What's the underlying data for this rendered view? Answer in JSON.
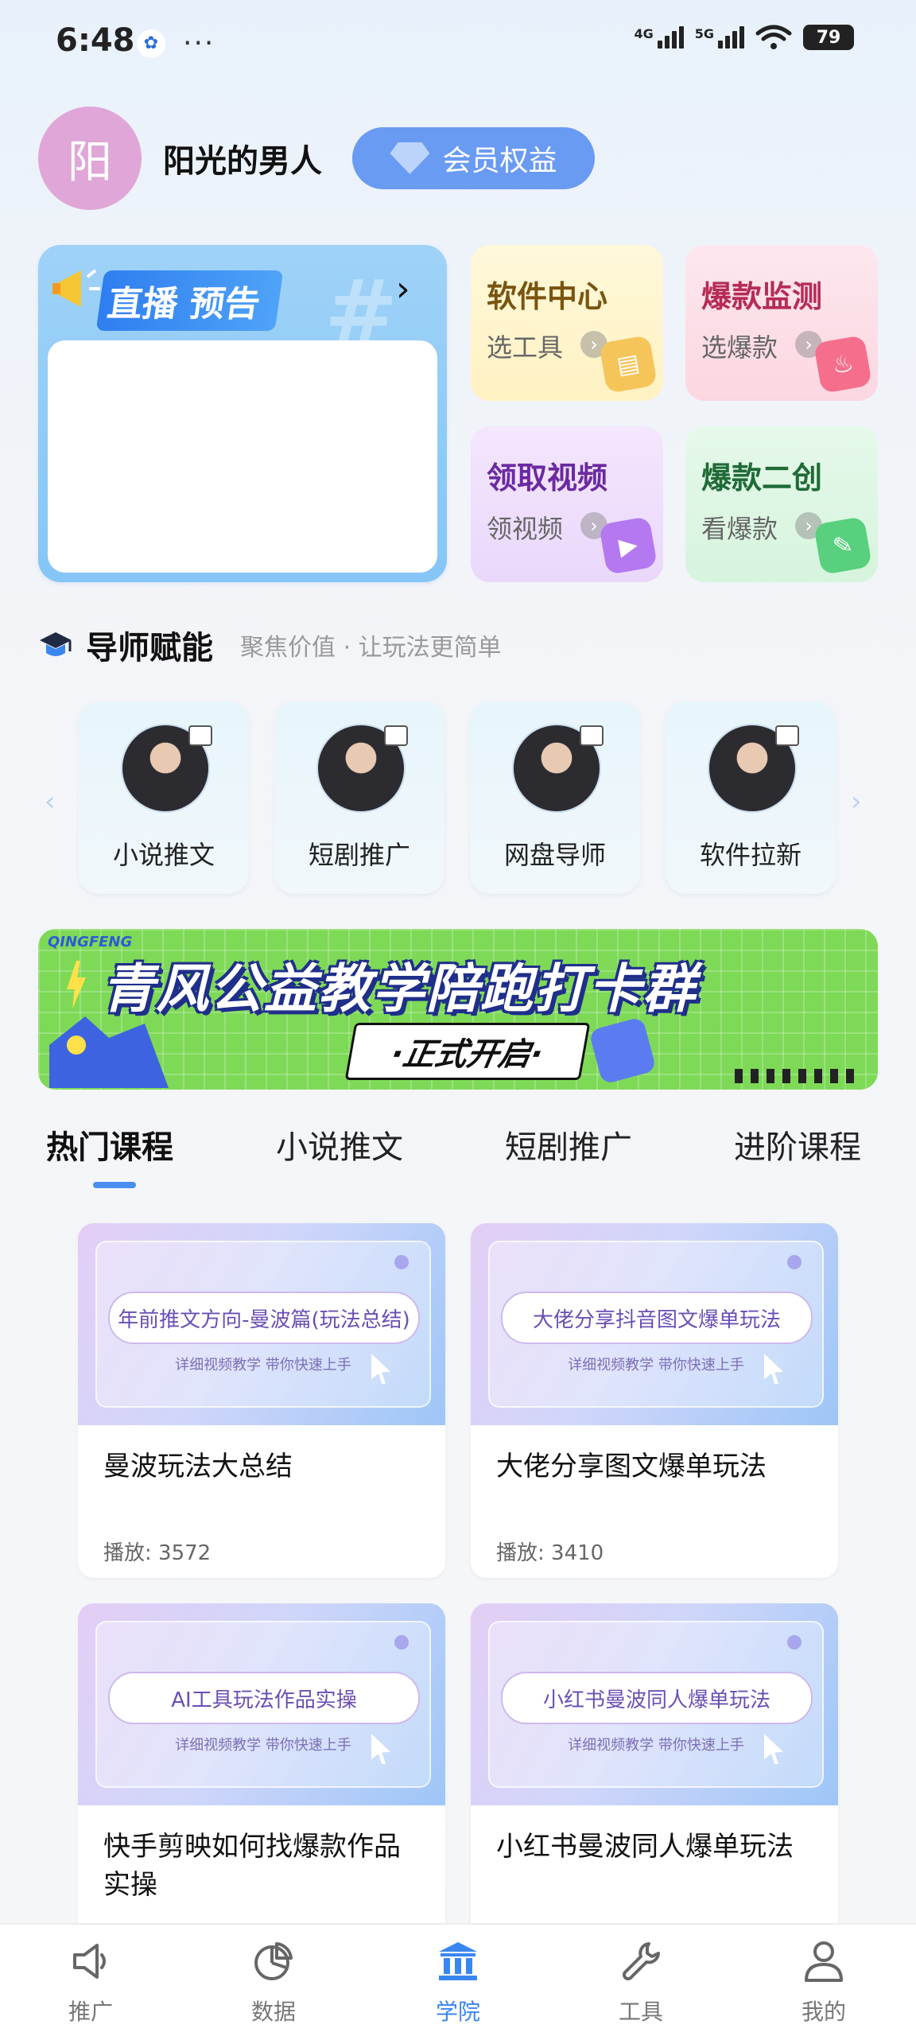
{
  "status_bar": {
    "time": "6:48",
    "network_1": "4G",
    "network_2": "5G",
    "battery": "79"
  },
  "user": {
    "avatar_char": "阳",
    "name": "阳光的男人",
    "vip_label": "会员权益"
  },
  "live": {
    "title": "直播 预告"
  },
  "tools": [
    {
      "title": "软件中心",
      "subtitle": "选工具"
    },
    {
      "title": "爆款监测",
      "subtitle": "选爆款"
    },
    {
      "title": "领取视频",
      "subtitle": "领视频"
    },
    {
      "title": "爆款二创",
      "subtitle": "看爆款"
    }
  ],
  "mentors": {
    "title": "导师赋能",
    "subtitle": "聚焦价值 · 让玩法更简单",
    "items": [
      {
        "name": "小说推文"
      },
      {
        "name": "短剧推广"
      },
      {
        "name": "网盘导师"
      },
      {
        "name": "软件拉新"
      }
    ]
  },
  "banner": {
    "tag": "QINGFENG",
    "title": "青风公益教学陪跑打卡群",
    "pill": "·正式开启·"
  },
  "tabs": [
    {
      "label": "热门课程",
      "active": true
    },
    {
      "label": "小说推文",
      "active": false
    },
    {
      "label": "短剧推广",
      "active": false
    },
    {
      "label": "进阶课程",
      "active": false
    }
  ],
  "courses": [
    {
      "thumb_title": "年前推文方向-曼波篇(玩法总结)",
      "thumb_sub": "详细视频教学  带你快速上手",
      "title": "曼波玩法大总结",
      "plays": "播放: 3572"
    },
    {
      "thumb_title": "大佬分享抖音图文爆单玩法",
      "thumb_sub": "详细视频教学  带你快速上手",
      "title": "大佬分享图文爆单玩法",
      "plays": "播放: 3410"
    },
    {
      "thumb_title": "AI工具玩法作品实操",
      "thumb_sub": "详细视频教学  带你快速上手",
      "title": "快手剪映如何找爆款作品实操",
      "plays": ""
    },
    {
      "thumb_title": "小红书曼波同人爆单玩法",
      "thumb_sub": "详细视频教学  带你快速上手",
      "title": "小红书曼波同人爆单玩法",
      "plays": ""
    }
  ],
  "bottom_nav": [
    {
      "label": "推广",
      "icon": "megaphone-icon",
      "active": false
    },
    {
      "label": "数据",
      "icon": "pie-chart-icon",
      "active": false
    },
    {
      "label": "学院",
      "icon": "academy-icon",
      "active": true
    },
    {
      "label": "工具",
      "icon": "wrench-icon",
      "active": false
    },
    {
      "label": "我的",
      "icon": "person-icon",
      "active": false
    }
  ],
  "colors": {
    "accent": "#3a86f0",
    "vip": "#6a9bf2",
    "avatar": "#e0a6d8"
  }
}
